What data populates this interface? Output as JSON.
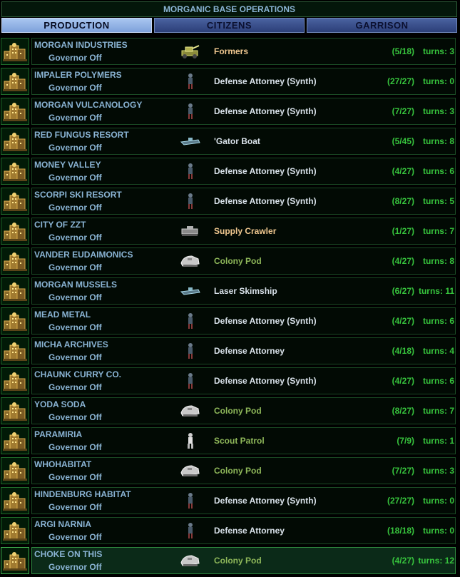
{
  "title": "MORGANIC BASE OPERATIONS",
  "tabs": [
    {
      "label": "PRODUCTION",
      "active": true
    },
    {
      "label": "CITIZENS",
      "active": false
    },
    {
      "label": "GARRISON",
      "active": false
    }
  ],
  "colors": {
    "unit_default": "#d9e2ea",
    "unit_terraform": "#f0c890",
    "unit_colony": "#8fb85a",
    "progress": "#37c43d",
    "base_name": "#8ab4d4"
  },
  "bases": [
    {
      "name": "MORGAN INDUSTRIES",
      "governor": "Governor Off",
      "unit": "Formers",
      "unit_icon": "formers-icon",
      "unit_color": "#f0c890",
      "progress": "(5/18)",
      "turns": "turns:  3"
    },
    {
      "name": "IMPALER POLYMERS",
      "governor": "Governor Off",
      "unit": "Defense Attorney (Synth)",
      "unit_icon": "infantry-icon",
      "unit_color": "#d9e2ea",
      "progress": "(27/27)",
      "turns": "turns:  0"
    },
    {
      "name": "MORGAN VULCANOLOGY",
      "governor": "Governor Off",
      "unit": "Defense Attorney (Synth)",
      "unit_icon": "infantry-icon",
      "unit_color": "#d9e2ea",
      "progress": "(7/27)",
      "turns": "turns:  3"
    },
    {
      "name": "RED FUNGUS RESORT",
      "governor": "Governor Off",
      "unit": "'Gator Boat",
      "unit_icon": "boat-icon",
      "unit_color": "#d9e2ea",
      "progress": "(5/45)",
      "turns": "turns:  8"
    },
    {
      "name": "MONEY VALLEY",
      "governor": "Governor Off",
      "unit": "Defense Attorney (Synth)",
      "unit_icon": "infantry-icon",
      "unit_color": "#d9e2ea",
      "progress": "(4/27)",
      "turns": "turns:  6"
    },
    {
      "name": "SCORPI SKI RESORT",
      "governor": "Governor Off",
      "unit": "Defense Attorney (Synth)",
      "unit_icon": "infantry-icon",
      "unit_color": "#d9e2ea",
      "progress": "(8/27)",
      "turns": "turns:  5"
    },
    {
      "name": "CITY OF ZZT",
      "governor": "Governor Off",
      "unit": "Supply Crawler",
      "unit_icon": "crawler-icon",
      "unit_color": "#f0c890",
      "progress": "(1/27)",
      "turns": "turns:  7"
    },
    {
      "name": "VANDER EUDAIMONICS",
      "governor": "Governor Off",
      "unit": "Colony Pod",
      "unit_icon": "colony-pod-icon",
      "unit_color": "#8fb85a",
      "progress": "(4/27)",
      "turns": "turns:  8"
    },
    {
      "name": "MORGAN MUSSELS",
      "governor": "Governor Off",
      "unit": "Laser Skimship",
      "unit_icon": "boat-icon",
      "unit_color": "#d9e2ea",
      "progress": "(6/27)",
      "turns": "turns:  11"
    },
    {
      "name": "MEAD METAL",
      "governor": "Governor Off",
      "unit": "Defense Attorney (Synth)",
      "unit_icon": "infantry-icon",
      "unit_color": "#d9e2ea",
      "progress": "(4/27)",
      "turns": "turns:  6"
    },
    {
      "name": "MICHA ARCHIVES",
      "governor": "Governor Off",
      "unit": "Defense Attorney",
      "unit_icon": "infantry-icon",
      "unit_color": "#d9e2ea",
      "progress": "(4/18)",
      "turns": "turns:  4"
    },
    {
      "name": "CHAUNK CURRY CO.",
      "governor": "Governor Off",
      "unit": "Defense Attorney (Synth)",
      "unit_icon": "infantry-icon",
      "unit_color": "#d9e2ea",
      "progress": "(4/27)",
      "turns": "turns:  6"
    },
    {
      "name": "YODA SODA",
      "governor": "Governor Off",
      "unit": "Colony Pod",
      "unit_icon": "colony-pod-icon",
      "unit_color": "#8fb85a",
      "progress": "(8/27)",
      "turns": "turns:  7"
    },
    {
      "name": "PARAMIRIA",
      "governor": "Governor Off",
      "unit": "Scout Patrol",
      "unit_icon": "scout-icon",
      "unit_color": "#8fb85a",
      "progress": "(7/9)",
      "turns": "turns:  1"
    },
    {
      "name": "WHOHABITAT",
      "governor": "Governor Off",
      "unit": "Colony Pod",
      "unit_icon": "colony-pod-icon",
      "unit_color": "#8fb85a",
      "progress": "(7/27)",
      "turns": "turns:  3"
    },
    {
      "name": "HINDENBURG HABITAT",
      "governor": "Governor Off",
      "unit": "Defense Attorney (Synth)",
      "unit_icon": "infantry-icon",
      "unit_color": "#d9e2ea",
      "progress": "(27/27)",
      "turns": "turns:  0"
    },
    {
      "name": "ARGI NARNIA",
      "governor": "Governor Off",
      "unit": "Defense Attorney",
      "unit_icon": "infantry-icon",
      "unit_color": "#d9e2ea",
      "progress": "(18/18)",
      "turns": "turns:  0"
    },
    {
      "name": "CHOKE ON THIS",
      "governor": "Governor Off",
      "unit": "Colony Pod",
      "unit_icon": "colony-pod-icon",
      "unit_color": "#8fb85a",
      "progress": "(4/27)",
      "turns": "turns:  12",
      "selected": true
    }
  ]
}
